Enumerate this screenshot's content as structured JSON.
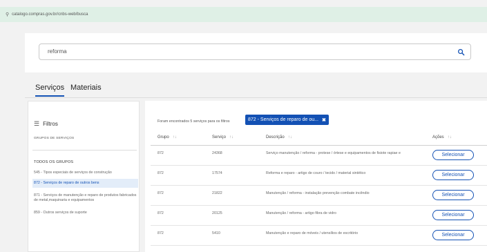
{
  "browser": {
    "url": "catalogo.compras.gov.br/cnbs-web/busca"
  },
  "search": {
    "value": "reforma"
  },
  "tabs": [
    {
      "label": "Serviços",
      "active": true
    },
    {
      "label": "Materiais",
      "active": false
    }
  ],
  "filters": {
    "title": "Filtros",
    "groups_caption": "GRUPOS DE SERVIÇOS",
    "all_groups": "TODOS OS GRUPOS",
    "items": [
      {
        "label": "545 - Tipos especiais de serviços de construção"
      },
      {
        "label": "872 - Serviços de reparo de outros bens",
        "active": true
      },
      {
        "label": "871 - Serviços de manutenção e reparo de produtos fabricados de metal,maquinaria e equipamentos"
      },
      {
        "label": "859 - Outros serviços de suporte"
      }
    ]
  },
  "results": {
    "found_text": "Foram encontrados 5 serviços para os filtros",
    "chip_label": "872 - Serviços de reparo de ou...",
    "chip_close": "✖",
    "columns": {
      "group": "Grupo",
      "service": "Serviço",
      "description": "Descrição",
      "actions": "Ações",
      "sort_glyph": "↑↓"
    },
    "action_label": "Selecionar",
    "rows": [
      {
        "group": "872",
        "service": "24368",
        "description": "Serviço manutenção / reforma - protese / órtese e equipamentos de fisiote rapiae e"
      },
      {
        "group": "872",
        "service": "17574",
        "description": "Reforma e reparo - artigo de couro / tecido / material sintético"
      },
      {
        "group": "872",
        "service": "21822",
        "description": "Manutenção / reforma - instalação prevenção combate incêndio"
      },
      {
        "group": "872",
        "service": "20125",
        "description": "Manutenção / reforma - artigo fibra de vidro"
      },
      {
        "group": "872",
        "service": "5410",
        "description": "Manutenção e reparo de móveis / utensílios de escritório"
      }
    ]
  },
  "colors": {
    "primary": "#1351b4",
    "url_bar_bg": "#dff0e6",
    "page_bg": "#f2f2f2"
  }
}
